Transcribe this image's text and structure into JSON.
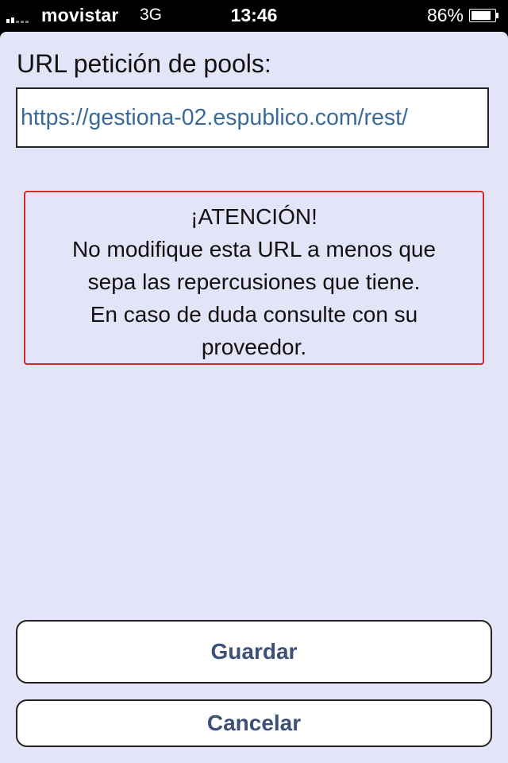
{
  "status_bar": {
    "carrier": "movistar",
    "network": "3G",
    "time": "13:46",
    "battery_percent": "86%",
    "battery_level": 0.86,
    "signal_bars": 2,
    "signal_bars_total": 5
  },
  "form": {
    "url_label": "URL petición de pools:",
    "url_value": "https://gestiona-02.espublico.com/rest/"
  },
  "warning": {
    "title": "¡ATENCIÓN!",
    "line1": "No modifique esta URL a menos que",
    "line2": "sepa las repercusiones que tiene.",
    "line3": "En caso de duda consulte con su",
    "line4": "proveedor.",
    "border_color": "#d42a2a"
  },
  "buttons": {
    "save_label": "Guardar",
    "cancel_label": "Cancelar"
  },
  "colors": {
    "background": "#e4e4f8",
    "url_text": "#3a6a9a",
    "button_text": "#3d5078"
  }
}
